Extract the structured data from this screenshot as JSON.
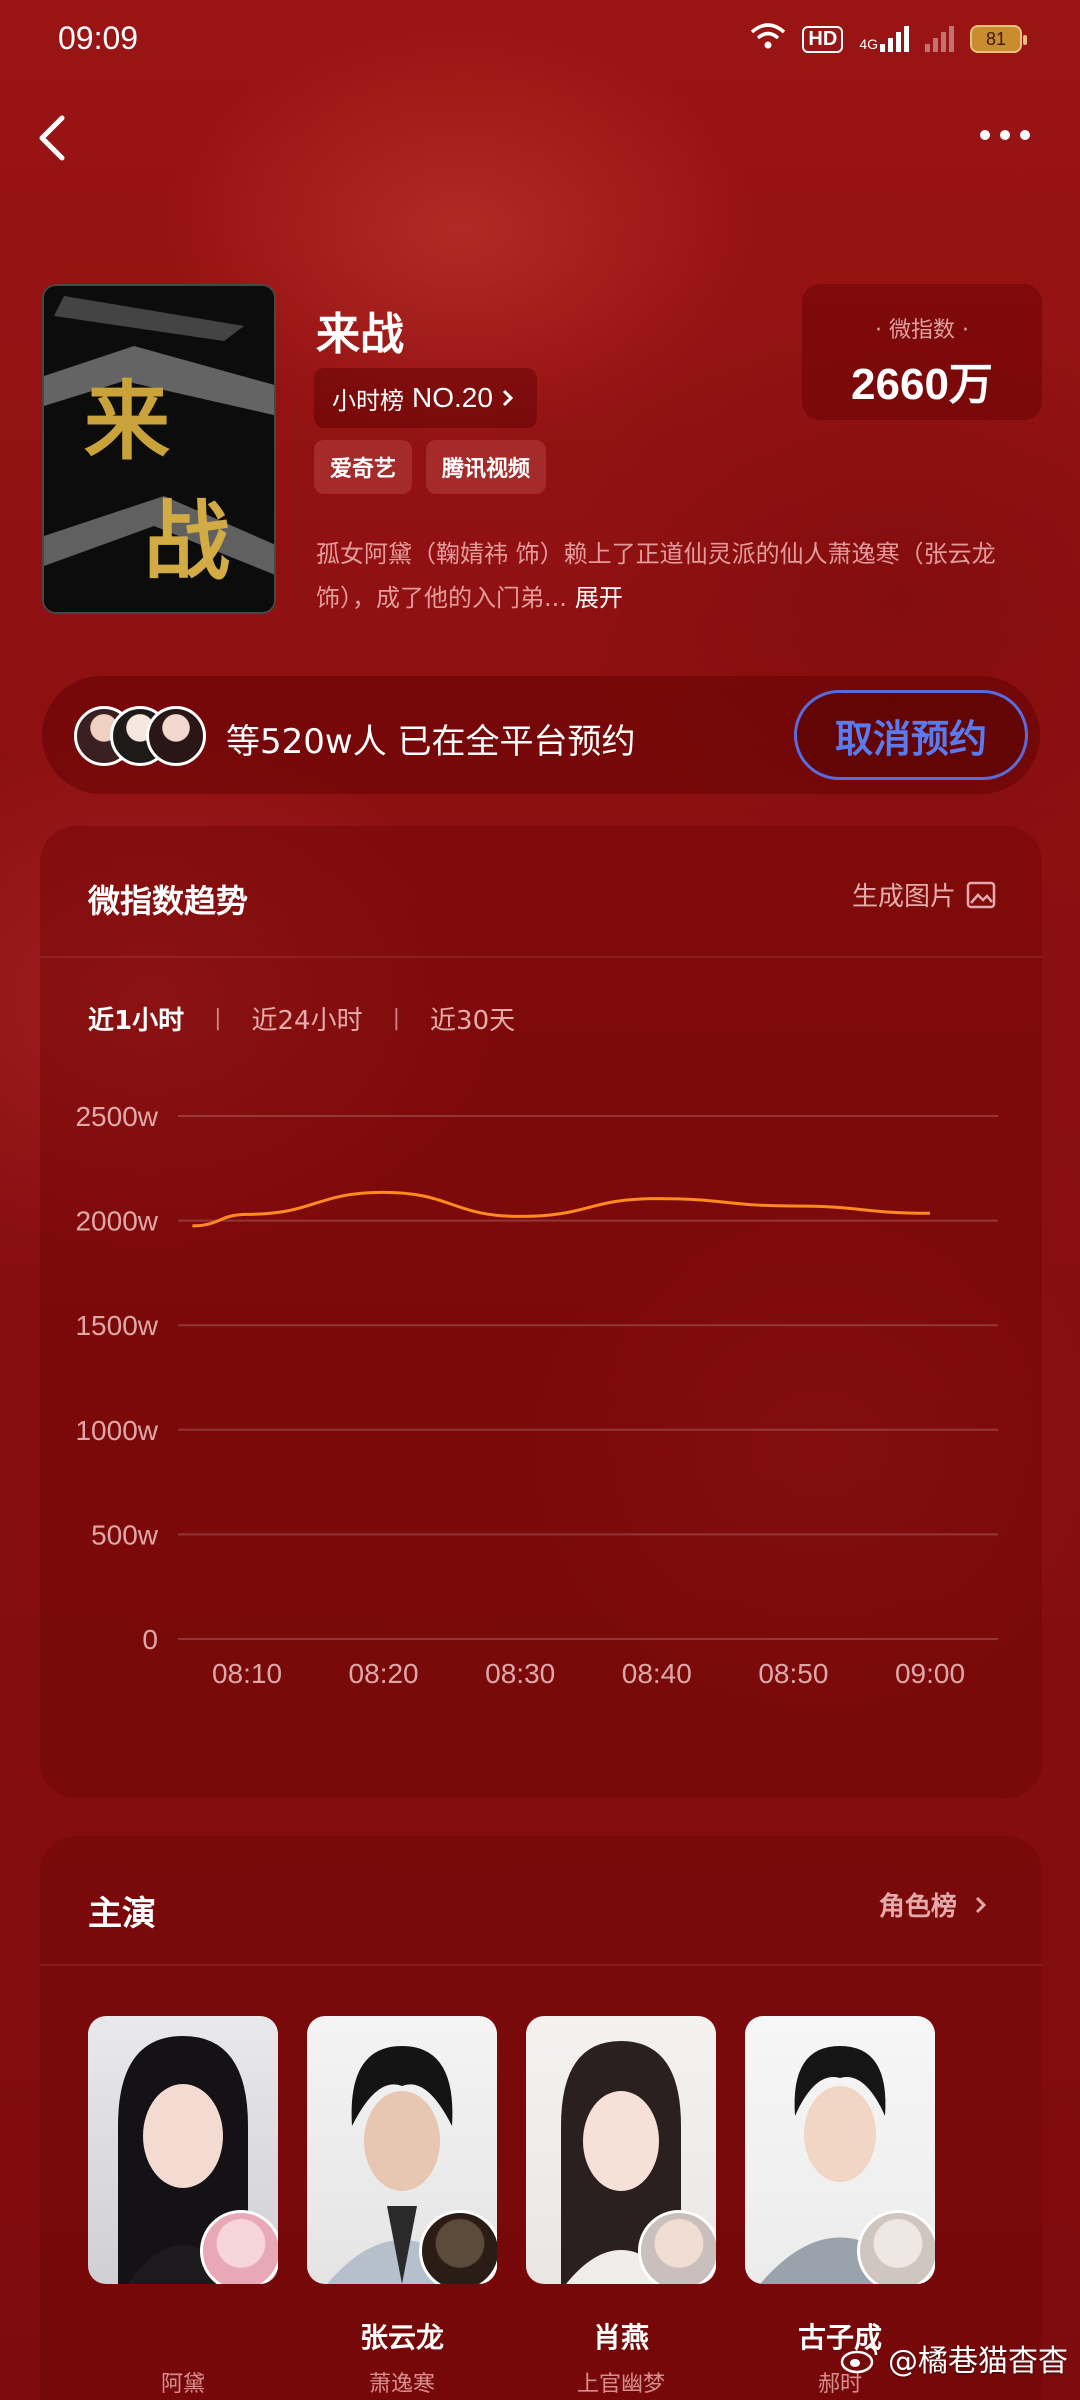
{
  "status_bar": {
    "time": "09:09",
    "hd_label": "HD",
    "network": "4G",
    "battery": "81"
  },
  "header": {
    "title": "来战",
    "rank_prefix": "小时榜",
    "rank_no": "NO.20",
    "platforms": [
      "爱奇艺",
      "腾讯视频"
    ],
    "description": "孤女阿黛（鞠婧祎 饰）赖上了正道仙灵派的仙人萧逸寒（张云龙饰），成了他的入门弟...",
    "expand_label": "展开",
    "poster_text": "来战",
    "index_label": "微指数",
    "index_value": "2660万"
  },
  "reservation": {
    "text": "等520w人 已在全平台预约",
    "cancel_label": "取消预约"
  },
  "trend": {
    "title": "微指数趋势",
    "generate_label": "生成图片",
    "tabs": [
      "近1小时",
      "近24小时",
      "近30天"
    ],
    "active_tab": 0
  },
  "chart_data": {
    "type": "line",
    "x": [
      "08:06",
      "08:10",
      "08:20",
      "08:30",
      "08:40",
      "08:50",
      "09:00"
    ],
    "x_ticks": [
      "08:10",
      "08:20",
      "08:30",
      "08:40",
      "08:50",
      "09:00"
    ],
    "y_ticks": [
      "0",
      "500w",
      "1000w",
      "1500w",
      "2000w",
      "2500w"
    ],
    "ylim": [
      0,
      2500
    ],
    "series": [
      {
        "values": [
          1975,
          2030,
          2135,
          2020,
          2105,
          2070,
          2035
        ],
        "color": "#ff8a1e"
      }
    ],
    "grid": true
  },
  "cast": {
    "title": "主演",
    "rank_label": "角色榜",
    "actors": [
      {
        "name": "",
        "role": "阿黛"
      },
      {
        "name": "张云龙",
        "role": "萧逸寒"
      },
      {
        "name": "肖燕",
        "role": "上官幽梦"
      },
      {
        "name": "古子成",
        "role": "郝时"
      }
    ]
  },
  "watermark": "@橘巷猫杳杳"
}
